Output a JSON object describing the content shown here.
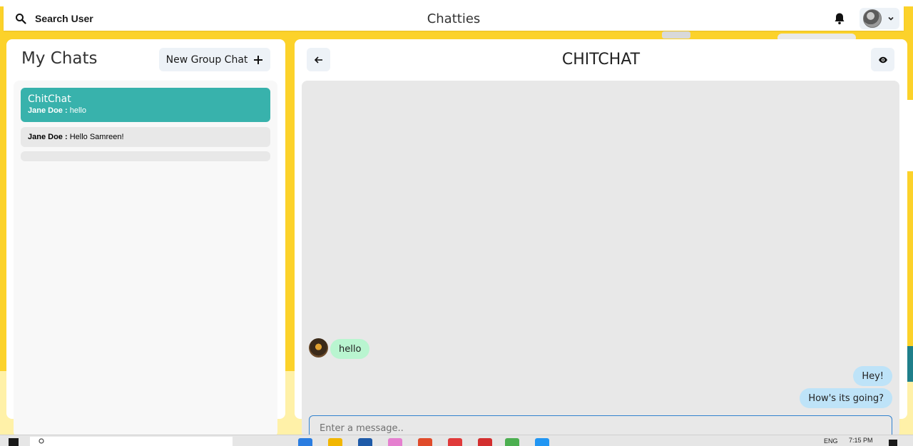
{
  "header": {
    "search_label": "Search User",
    "app_title": "Chatties"
  },
  "sidebar": {
    "title": "My Chats",
    "new_group_label": "New Group Chat",
    "chats": [
      {
        "name": "ChitChat",
        "sender": "Jane Doe :",
        "message": "hello",
        "active": true
      },
      {
        "name": "",
        "sender": "Jane Doe :",
        "message": "Hello Samreen!",
        "active": false
      },
      {
        "name": "",
        "sender": "",
        "message": "",
        "active": false
      }
    ]
  },
  "conversation": {
    "title": "CHITCHAT",
    "messages": [
      {
        "text": "hello",
        "direction": "incoming"
      },
      {
        "text": "Hey!",
        "direction": "outgoing"
      },
      {
        "text": "How's its going?",
        "direction": "outgoing"
      }
    ],
    "input_placeholder": "Enter a message.."
  },
  "taskbar": {
    "language": "ENG",
    "time": "7:15 PM"
  },
  "colors": {
    "background": "#fcd22a",
    "active_chat": "#38b2ac",
    "incoming_bubble": "#b9f5d0",
    "outgoing_bubble": "#bee3f8",
    "input_border": "#3182ce"
  },
  "icons": [
    "search-icon",
    "bell-icon",
    "chevron-down-icon",
    "plus-icon",
    "arrow-left-icon",
    "eye-icon",
    "windows-icon"
  ]
}
